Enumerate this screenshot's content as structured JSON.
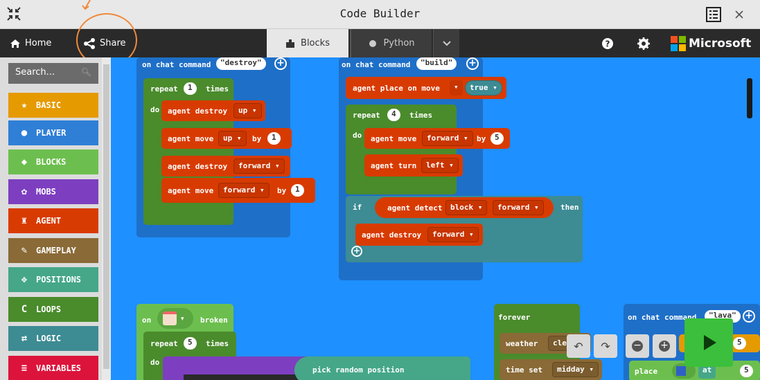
{
  "window": {
    "title": "Code Builder"
  },
  "menu": {
    "home": "Home",
    "share": "Share",
    "brand": "Microsoft"
  },
  "tabs": {
    "blocks": "Blocks",
    "python": "Python"
  },
  "search": {
    "placeholder": "Search..."
  },
  "categories": [
    {
      "label": "BASIC",
      "color": "#e59a00"
    },
    {
      "label": "PLAYER",
      "color": "#2f7fd6"
    },
    {
      "label": "BLOCKS",
      "color": "#6cbf4e"
    },
    {
      "label": "MOBS",
      "color": "#7d3fc0"
    },
    {
      "label": "AGENT",
      "color": "#d83b01"
    },
    {
      "label": "GAMEPLAY",
      "color": "#8a6a36"
    },
    {
      "label": "POSITIONS",
      "color": "#45a788"
    },
    {
      "label": "LOOPS",
      "color": "#4a8b2c"
    },
    {
      "label": "LOGIC",
      "color": "#3d8b93"
    },
    {
      "label": "VARIABLES",
      "color": "#dc143c"
    }
  ],
  "blocks": {
    "destroy": {
      "header": "on chat command",
      "command": "\"destroy\"",
      "repeat": "repeat",
      "repeat_count": "1",
      "times": "times",
      "do": "do",
      "line1_a": "agent destroy",
      "line1_dd": "up ▾",
      "line2_a": "agent move",
      "line2_dd": "up ▾",
      "line2_by": "by",
      "line2_n": "1",
      "line3_a": "agent destroy",
      "line3_dd": "forward ▾",
      "line4_a": "agent move",
      "line4_dd": "forward ▾",
      "line4_by": "by",
      "line4_n": "1"
    },
    "build": {
      "header": "on chat command",
      "command": "\"build\"",
      "place_a": "agent place on move",
      "place_dd": "▾",
      "place_val": "true ▾",
      "repeat": "repeat",
      "repeat_count": "4",
      "times": "times",
      "do": "do",
      "move_a": "agent move",
      "move_dd": "forward ▾",
      "move_by": "by",
      "move_n": "5",
      "turn_a": "agent turn",
      "turn_dd": "left ▾",
      "if": "if",
      "detect_a": "agent detect",
      "detect_dd1": "block ▾",
      "detect_dd2": "forward ▾",
      "then": "then",
      "destroy_a": "agent destroy",
      "destroy_dd": "forward ▾"
    },
    "broken": {
      "on": "on",
      "broken": "broken",
      "repeat": "repeat",
      "repeat_count": "5",
      "times": "times",
      "do": "do",
      "pick": "pick random position"
    },
    "forever": {
      "label": "forever",
      "weather": "weather",
      "weather_val": "cle",
      "time": "time set",
      "time_val": "midday ▾"
    },
    "lava": {
      "header": "on chat command",
      "command": "\"lava\"",
      "place": "place",
      "at": "at",
      "n1": "5",
      "n2": "5"
    }
  }
}
